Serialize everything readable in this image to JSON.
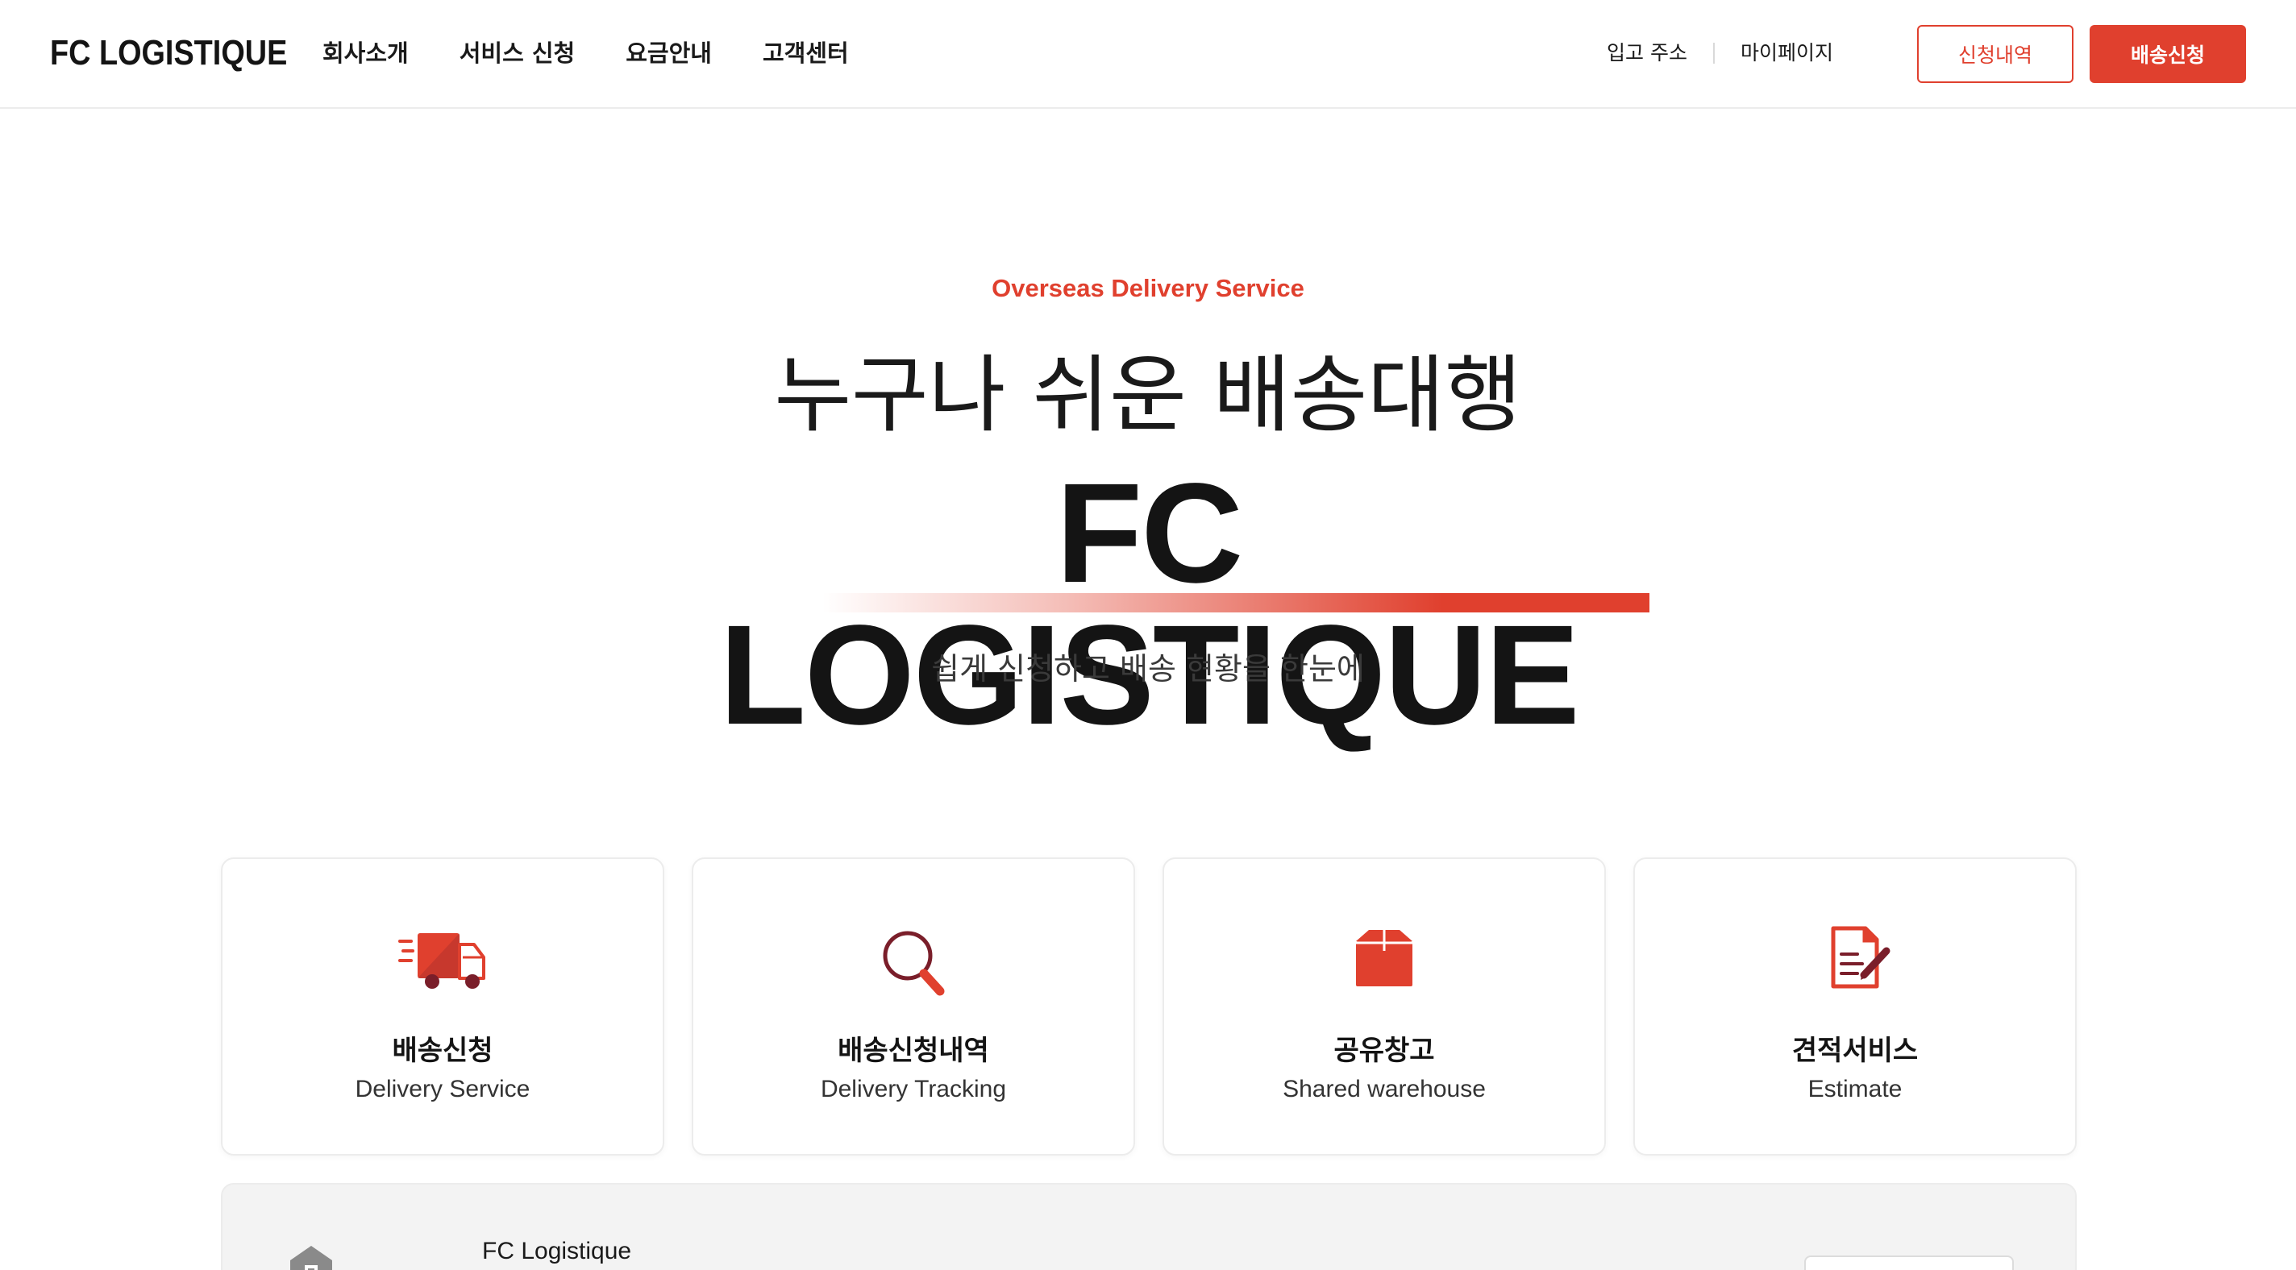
{
  "header": {
    "logo": "FC LOGISTIQUE",
    "nav": [
      "회사소개",
      "서비스 신청",
      "요금안내",
      "고객센터"
    ],
    "util_links": [
      "입고 주소",
      "마이페이지"
    ],
    "btn_history": "신청내역",
    "btn_apply": "배송신청"
  },
  "hero": {
    "tag": "Overseas Delivery Service",
    "subtitle": "누구나 쉬운 배송대행",
    "title": "FC LOGISTIQUE",
    "description": "쉽게 신청하고 배송 현황을 한눈에"
  },
  "cards": [
    {
      "title": "배송신청",
      "sub": "Delivery Service",
      "icon": "delivery-truck-icon"
    },
    {
      "title": "배송신청내역",
      "sub": "Delivery Tracking",
      "icon": "magnifier-icon"
    },
    {
      "title": "공유창고",
      "sub": "Shared warehouse",
      "icon": "box-icon"
    },
    {
      "title": "견적서비스",
      "sub": "Estimate",
      "icon": "document-edit-icon"
    }
  ],
  "info": {
    "name": "FC Logistique",
    "icon": "warehouse-icon"
  },
  "colors": {
    "accent": "#e0402e",
    "dark_accent": "#7a1e2a",
    "text": "#141414"
  }
}
